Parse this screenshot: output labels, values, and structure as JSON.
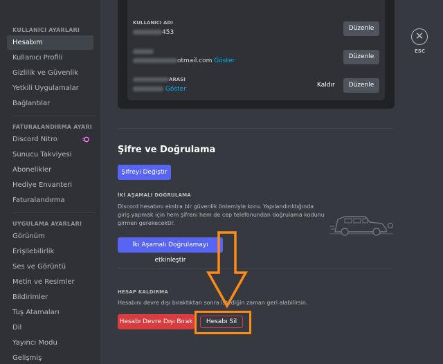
{
  "sidebar": {
    "user_settings_header": "KULLANICI AYARLARI",
    "user_items": [
      "Hesabım",
      "Kullanıcı Profili",
      "Gizlilik ve Güvenlik",
      "Yetkili Uygulamalar",
      "Bağlantılar"
    ],
    "billing_header": "FATURALANDIRMA AYARLA...",
    "billing_items": [
      "Discord Nitro",
      "Sunucu Takviyesi",
      "Abonelikler",
      "Hediye Envanteri",
      "Faturalandırma"
    ],
    "app_header": "UYGULAMA AYARLARI",
    "app_items": [
      "Görünüm",
      "Erişilebilirlik",
      "Ses ve Görüntü",
      "Metin ve Resimler",
      "Bildirimler",
      "Tuş Atamaları",
      "Dil",
      "Yayıncı Modu",
      "Gelişmiş"
    ]
  },
  "account_card": {
    "username_label": "KULLANICI ADI",
    "username_suffix": "453",
    "email_suffix": "otmail.com",
    "email_show": "Göster",
    "phone_label_suffix": "ARASI",
    "phone_show": "Göster",
    "edit_label": "Düzenle",
    "remove_label": "Kaldır"
  },
  "security": {
    "title": "Şifre ve Doğrulama",
    "change_password": "Şifreyi Değiştir",
    "two_factor_header": "İKİ AŞAMALI DOĞRULAMA",
    "two_factor_desc": "Discord hesabını ekstra bir güvenlik önlemiyle koru. Yapılandırıldığında giriş yapmak için hem şifreni hem de cep telefonundan doğrulama kodunu girmen gerekecektir.",
    "enable_2fa": "İki Aşamalı Doğrulamayı etkinleştir"
  },
  "removal": {
    "header": "HESAP KALDIRMA",
    "desc": "Hesabını devre dışı bıraktıktan sonra istediğin zaman geri alabilirsin.",
    "disable_button": "Hesabı Devre Dışı Bırak",
    "delete_button": "Hesabı Sil"
  },
  "close": {
    "esc_label": "ESC"
  },
  "colors": {
    "blurple": "#5865f2",
    "danger": "#d83c3e",
    "annotation": "#ff8c1a",
    "link": "#00b0f4"
  }
}
